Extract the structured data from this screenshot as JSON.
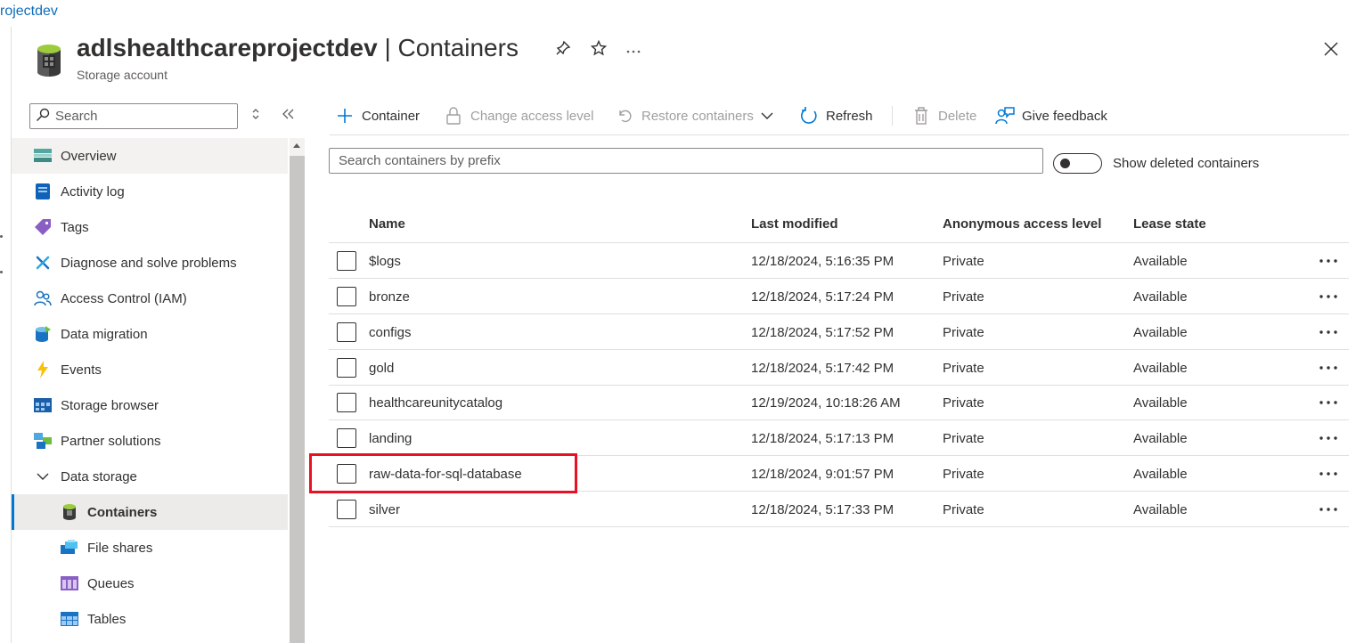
{
  "breadcrumb": {
    "text": "rojectdev"
  },
  "header": {
    "resource_name": "adlshealthcareprojectdev",
    "separator": " | ",
    "blade_title": "Containers",
    "subtitle": "Storage account",
    "icons": {
      "pin": "pin-icon",
      "favorite": "star-icon",
      "more": "ellipsis-icon",
      "close": "close-icon"
    }
  },
  "sidebar": {
    "search_placeholder": "Search",
    "items": [
      {
        "label": "Overview",
        "icon": "overview-icon",
        "indent": false,
        "state": "hover"
      },
      {
        "label": "Activity log",
        "icon": "activity-log-icon",
        "indent": false
      },
      {
        "label": "Tags",
        "icon": "tag-icon",
        "indent": false
      },
      {
        "label": "Diagnose and solve problems",
        "icon": "wrench-icon",
        "indent": false
      },
      {
        "label": "Access Control (IAM)",
        "icon": "people-icon",
        "indent": false
      },
      {
        "label": "Data migration",
        "icon": "data-migration-icon",
        "indent": false
      },
      {
        "label": "Events",
        "icon": "lightning-icon",
        "indent": false
      },
      {
        "label": "Storage browser",
        "icon": "storage-browser-icon",
        "indent": false
      },
      {
        "label": "Partner solutions",
        "icon": "partner-solutions-icon",
        "indent": false
      },
      {
        "label": "Data storage",
        "icon": "chevron-down-icon",
        "indent": false,
        "group": true
      },
      {
        "label": "Containers",
        "icon": "container-icon",
        "indent": true,
        "state": "selected"
      },
      {
        "label": "File shares",
        "icon": "file-shares-icon",
        "indent": true
      },
      {
        "label": "Queues",
        "icon": "queues-icon",
        "indent": true
      },
      {
        "label": "Tables",
        "icon": "tables-icon",
        "indent": true
      }
    ]
  },
  "toolbar": {
    "add_container": "Container",
    "change_access": "Change access level",
    "restore": "Restore containers",
    "refresh": "Refresh",
    "delete": "Delete",
    "feedback": "Give feedback"
  },
  "filter": {
    "search_placeholder": "Search containers by prefix",
    "show_deleted_label": "Show deleted containers",
    "show_deleted": false
  },
  "table": {
    "columns": [
      "Name",
      "Last modified",
      "Anonymous access level",
      "Lease state"
    ],
    "rows": [
      {
        "name": "$logs",
        "modified": "12/18/2024, 5:16:35 PM",
        "access": "Private",
        "lease": "Available"
      },
      {
        "name": "bronze",
        "modified": "12/18/2024, 5:17:24 PM",
        "access": "Private",
        "lease": "Available"
      },
      {
        "name": "configs",
        "modified": "12/18/2024, 5:17:52 PM",
        "access": "Private",
        "lease": "Available"
      },
      {
        "name": "gold",
        "modified": "12/18/2024, 5:17:42 PM",
        "access": "Private",
        "lease": "Available"
      },
      {
        "name": "healthcareunitycatalog",
        "modified": "12/19/2024, 10:18:26 AM",
        "access": "Private",
        "lease": "Available"
      },
      {
        "name": "landing",
        "modified": "12/18/2024, 5:17:13 PM",
        "access": "Private",
        "lease": "Available"
      },
      {
        "name": "raw-data-for-sql-database",
        "modified": "12/18/2024, 9:01:57 PM",
        "access": "Private",
        "lease": "Available",
        "highlighted": true
      },
      {
        "name": "silver",
        "modified": "12/18/2024, 5:17:33 PM",
        "access": "Private",
        "lease": "Available"
      }
    ]
  },
  "colors": {
    "accent": "#0078d4",
    "link": "#0f6cbd",
    "highlight": "#e81123",
    "text": "#323130",
    "disabled": "#a19f9d"
  }
}
